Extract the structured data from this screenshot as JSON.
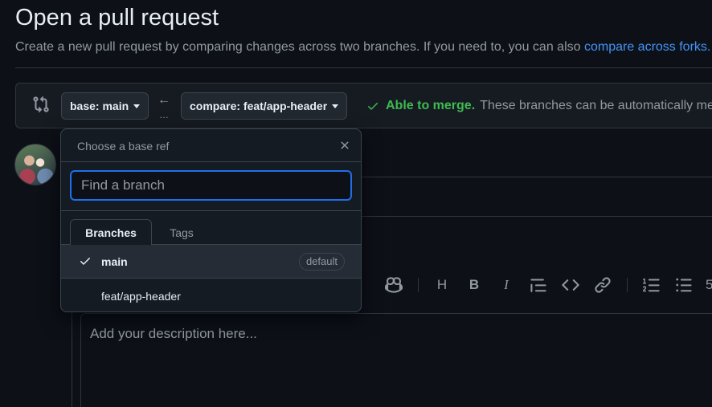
{
  "page": {
    "title": "Open a pull request",
    "subtitle": "Create a new pull request by comparing changes across two branches. If you need to, you can also",
    "subtitle_link": "compare across forks."
  },
  "compare": {
    "base_label": "base: main",
    "compare_label": "compare: feat/app-header",
    "merge_ok": "Able to merge.",
    "merge_desc": "These branches can be automatically merged.",
    "arrow": "←",
    "dots": "…"
  },
  "dropdown": {
    "title": "Choose a base ref",
    "filter_placeholder": "Find a branch",
    "tabs": [
      {
        "label": "Branches",
        "active": true
      },
      {
        "label": "Tags",
        "active": false
      }
    ],
    "branches": [
      {
        "name": "main",
        "selected": true,
        "badge": "default"
      },
      {
        "name": "feat/app-header",
        "selected": false,
        "badge": ""
      }
    ]
  },
  "editor": {
    "placeholder": "Add your description here..."
  },
  "colors": {
    "background": "#0d1117",
    "accent": "#1f6feb",
    "link": "#4493f8",
    "success": "#3fb950"
  }
}
